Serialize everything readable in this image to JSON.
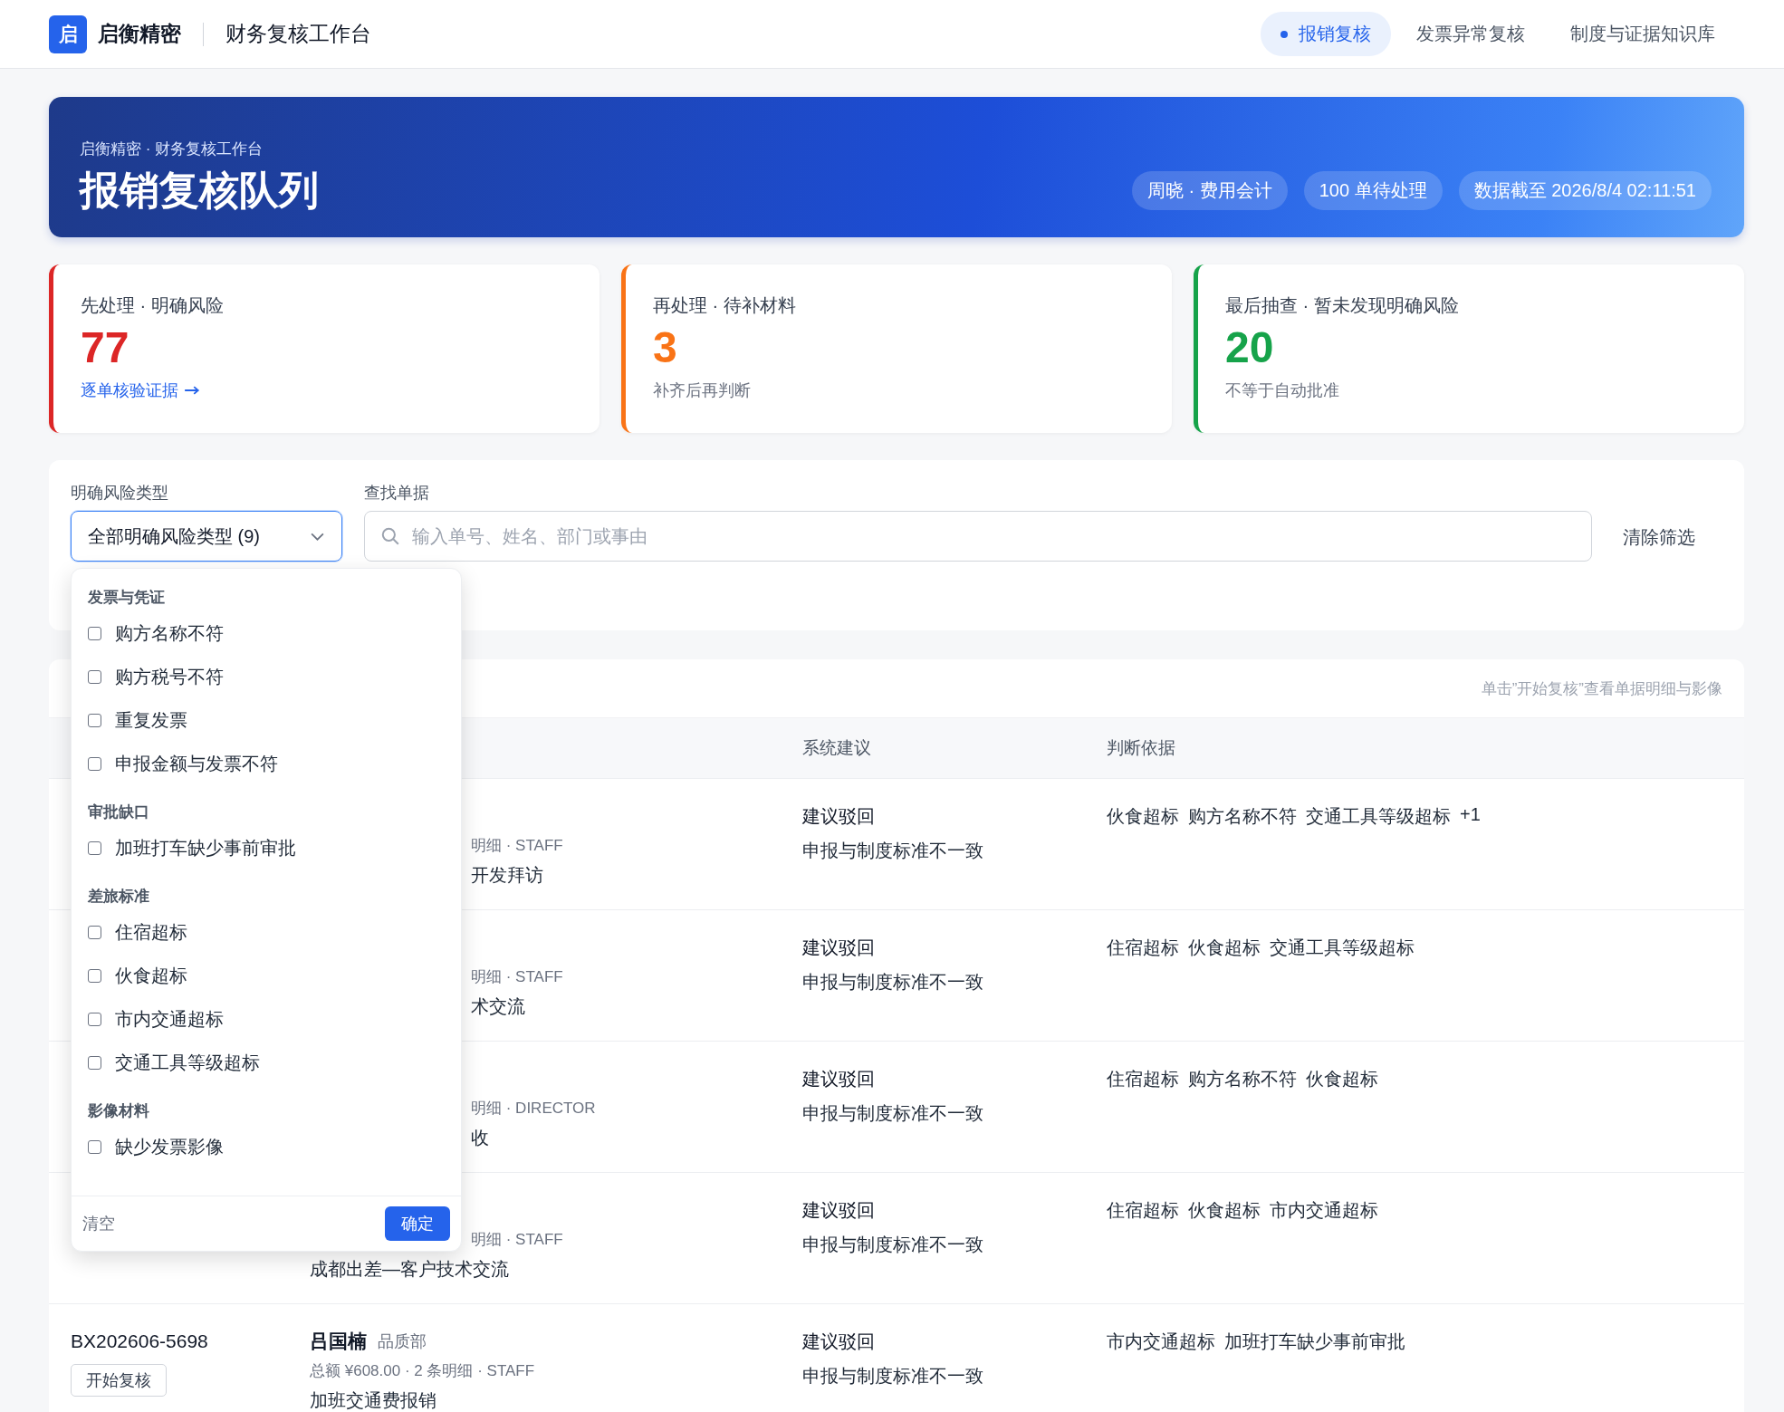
{
  "brand": {
    "logo": "启",
    "name": "启衡精密",
    "product": "财务复核工作台"
  },
  "nav": [
    {
      "label": "报销复核",
      "selected": true
    },
    {
      "label": "发票异常复核",
      "selected": false
    },
    {
      "label": "制度与证据知识库",
      "selected": false
    }
  ],
  "banner": {
    "eyebrow": "启衡精密 · 财务复核工作台",
    "title": "报销复核队列",
    "chips": [
      "周晓 · 费用会计",
      "100 单待处理",
      "数据截至 2026/8/4 02:11:51"
    ]
  },
  "stats": [
    {
      "label": "先处理 · 明确风险",
      "value": "77",
      "color": "#dc2626",
      "foot": {
        "kind": "link",
        "text": "逐单核验证据"
      }
    },
    {
      "label": "再处理 · 待补材料",
      "value": "3",
      "color": "#f97316",
      "foot": {
        "kind": "note",
        "text": "补齐后再判断"
      }
    },
    {
      "label": "最后抽查 · 暂未发现明确风险",
      "value": "20",
      "color": "#16a34a",
      "foot": {
        "kind": "note",
        "text": "不等于自动批准"
      }
    }
  ],
  "filters": {
    "risk_label": "明确风险类型",
    "risk_value": "全部明确风险类型 (9)",
    "expanded": true,
    "search_label": "查找单据",
    "search_placeholder": "输入单号、姓名、部门或事由",
    "clear": "清除筛选"
  },
  "risk_menu": {
    "groups": [
      {
        "title": "发票与凭证",
        "options": [
          {
            "label": "购方名称不符",
            "checked": false
          },
          {
            "label": "购方税号不符",
            "checked": false
          },
          {
            "label": "重复发票",
            "checked": false
          },
          {
            "label": "申报金额与发票不符",
            "checked": false
          }
        ]
      },
      {
        "title": "审批缺口",
        "options": [
          {
            "label": "加班打车缺少事前审批",
            "checked": false
          }
        ]
      },
      {
        "title": "差旅标准",
        "options": [
          {
            "label": "住宿超标",
            "checked": false
          },
          {
            "label": "伙食超标",
            "checked": false
          },
          {
            "label": "市内交通超标",
            "checked": false
          },
          {
            "label": "交通工具等级超标",
            "checked": false
          }
        ]
      },
      {
        "title": "影像材料",
        "options": [
          {
            "label": "缺少发票影像",
            "checked": false
          }
        ]
      }
    ],
    "clear": "清空",
    "confirm": "确定"
  },
  "table": {
    "hint": "单击”开始复核”查看单据明细与影像",
    "columns": [
      "系统建议",
      "判断依据"
    ],
    "rows": [
      {
        "meta": {
          "text": "明细 · STAFF",
          "covered": true
        },
        "title": {
          "text": "开发拜访",
          "covered": true
        },
        "suggestion": "建议驳回",
        "reason": "申报与制度标准不一致",
        "tags": [
          "伙食超标",
          "购方名称不符",
          "交通工具等级超标",
          "+1"
        ]
      },
      {
        "meta": {
          "text": "明细 · STAFF",
          "covered": true
        },
        "title": {
          "text": "术交流",
          "covered": true
        },
        "suggestion": "建议驳回",
        "reason": "申报与制度标准不一致",
        "tags": [
          "住宿超标",
          "伙食超标",
          "交通工具等级超标"
        ]
      },
      {
        "meta": {
          "text": "明细 · DIRECTOR",
          "covered": true
        },
        "title": {
          "text": "收",
          "covered": true
        },
        "suggestion": "建议驳回",
        "reason": "申报与制度标准不一致",
        "tags": [
          "住宿超标",
          "购方名称不符",
          "伙食超标"
        ]
      },
      {
        "meta": {
          "text": "明细 · STAFF",
          "covered": true
        },
        "title": {
          "text": "成都出差—客户技术交流",
          "covered": false
        },
        "suggestion": "建议驳回",
        "reason": "申报与制度标准不一致",
        "tags": [
          "住宿超标",
          "伙食超标",
          "市内交通超标"
        ]
      },
      {
        "id": "BX202606-5698",
        "button": "开始复核",
        "name": "吕国楠",
        "dept": "品质部",
        "meta": {
          "text": "总额 ¥608.00 · 2 条明细 · STAFF",
          "covered": false
        },
        "title": {
          "text": "加班交通费报销",
          "covered": false
        },
        "suggestion": "建议驳回",
        "reason": "申报与制度标准不一致",
        "tags": [
          "市内交通超标",
          "加班打车缺少事前审批"
        ]
      }
    ]
  }
}
